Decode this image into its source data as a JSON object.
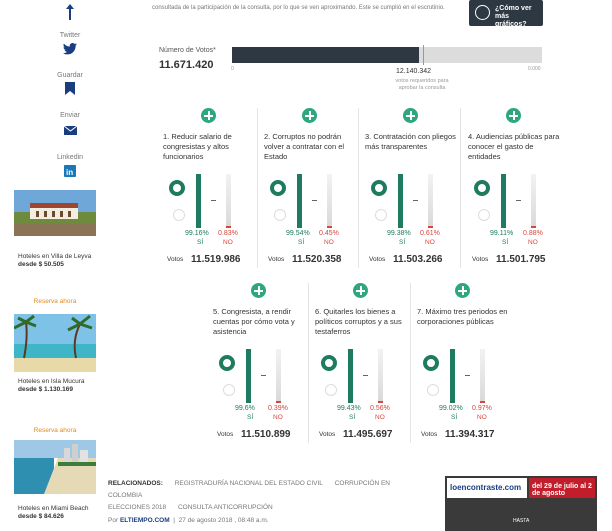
{
  "sidebar": {
    "share_items": [
      {
        "label": "Twitter",
        "icon": "twitter-icon"
      },
      {
        "label": "Guardar",
        "icon": "bookmark-icon"
      },
      {
        "label": "Enviar",
        "icon": "mail-icon"
      },
      {
        "label": "Linkedin",
        "icon": "linkedin-icon"
      }
    ],
    "ads": [
      {
        "caption": "Hoteles en Villa de Leyva",
        "price": "desde $ 50.505"
      },
      {
        "caption": "Hoteles en Isla Mucura",
        "price": "desde $ 1.130.169"
      },
      {
        "caption": "Hoteles en Miami Beach",
        "price": "desde $ 84.626"
      }
    ],
    "promo_link": "Reserva ahora"
  },
  "main": {
    "top_note": "consultada de la participación de la consulta, por lo que se ven aproximando. Este se cumplió en el escrutinio.",
    "more_button": "¿Cómo ver más gráficos?",
    "votes_label": "Número de Votos*",
    "votes_value": "11.671.420",
    "threshold_value": "12.140.342",
    "threshold_text": "votos requeridos para aprobar la consulta",
    "bar_start": "0",
    "bar_end": "0.000",
    "votes_fraction": 0.604,
    "threshold_fraction": 0.615
  },
  "cards": [
    {
      "title": "1. Reducir salario de congresistas y altos funcionarios",
      "si": "99.16%",
      "no": "0.83%",
      "votos": "11.519.986"
    },
    {
      "title": "2. Corruptos no podrán volver a contratar con el Estado",
      "si": "99.54%",
      "no": "0.45%",
      "votos": "11.520.358"
    },
    {
      "title": "3. Contratación con pliegos más transparentes",
      "si": "99.38%",
      "no": "0.61%",
      "votos": "11.503.266"
    },
    {
      "title": "4. Audiencias públicas para conocer el gasto de entidades",
      "si": "99.11%",
      "no": "0.88%",
      "votos": "11.501.795"
    },
    {
      "title": "5. Congresista, a rendir cuentas por cómo vota y asistencia",
      "si": "99.6%",
      "no": "0.39%",
      "votos": "11.510.899"
    },
    {
      "title": "6. Quitarles los bienes a políticos corruptos y a sus testaferros",
      "si": "99.43%",
      "no": "0.56%",
      "votos": "11.495.697"
    },
    {
      "title": "7. Máximo tres periodos en corporaciones públicas",
      "si": "99.02%",
      "no": "0.97%",
      "votos": "11.394.317"
    }
  ],
  "labels": {
    "si": "SÍ",
    "no": "NO",
    "votos": "Votos"
  },
  "related": {
    "heading": "RELACIONADOS:",
    "items": [
      "REGISTRADURÍA NACIONAL DEL ESTADO CIVIL",
      "CORRUPCIÓN EN COLOMBIA",
      "ELECCIONES 2018",
      "CONSULTA ANTICORRUPCIÓN"
    ]
  },
  "byline": {
    "prefix": "Por",
    "source": "ELTIEMPO.COM",
    "date": "27 de agosto 2018 , 08:48 a.m."
  },
  "promo_banner": {
    "brand": "loencontraste.com",
    "dates": "del 29 de julio al 2 de agosto",
    "sub": "HASTA"
  },
  "colors": {
    "si": "#1f7b5f",
    "no": "#d9453c",
    "plus": "#2ea77d",
    "dark": "#2d3842"
  }
}
